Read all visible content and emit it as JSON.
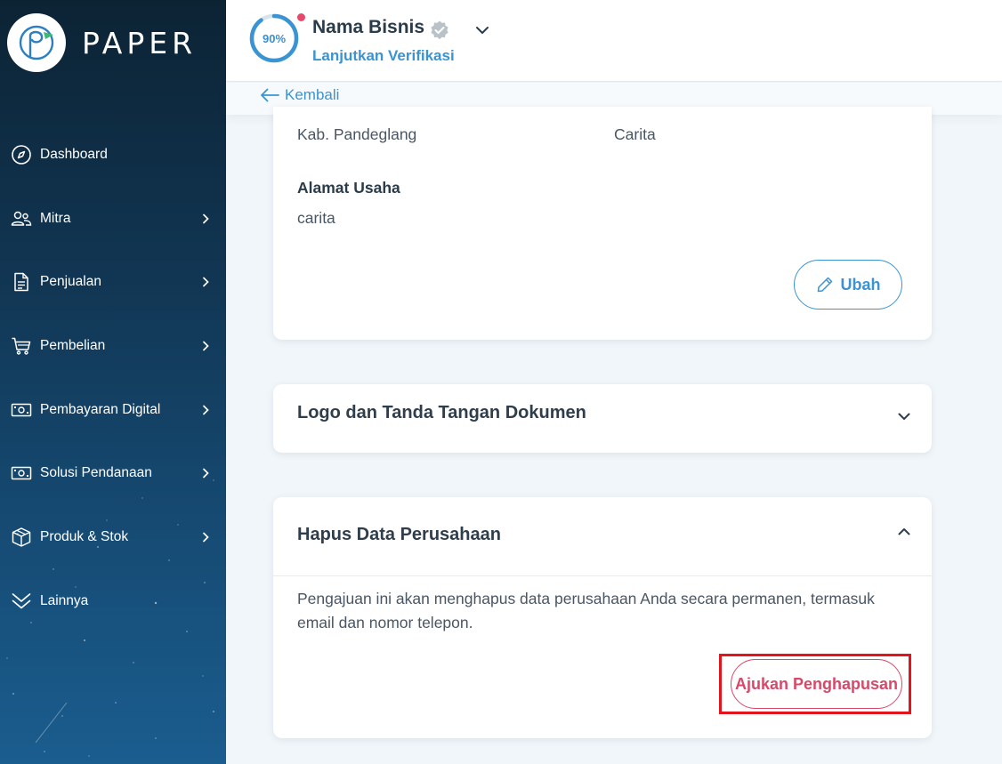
{
  "brand": {
    "name": "PAPER"
  },
  "sidebar": {
    "items": [
      {
        "label": "Dashboard",
        "icon": "compass-icon",
        "has_submenu": false
      },
      {
        "label": "Mitra",
        "icon": "users-icon",
        "has_submenu": true
      },
      {
        "label": "Penjualan",
        "icon": "document-icon",
        "has_submenu": true
      },
      {
        "label": "Pembelian",
        "icon": "cart-icon",
        "has_submenu": true
      },
      {
        "label": "Pembayaran Digital",
        "icon": "banknote-icon",
        "has_submenu": true
      },
      {
        "label": "Solusi Pendanaan",
        "icon": "banknote-icon",
        "has_submenu": true
      },
      {
        "label": "Produk & Stok",
        "icon": "box-icon",
        "has_submenu": true
      },
      {
        "label": "Lainnya",
        "icon": "double-chevron-down-icon",
        "has_submenu": false
      }
    ]
  },
  "header": {
    "progress_text": "90%",
    "progress_value": 0.9,
    "business_name": "Nama Bisnis",
    "verify_link": "Lanjutkan Verifikasi"
  },
  "backbar": {
    "label": "Kembali"
  },
  "company_card": {
    "region_left": "Kab. Pandeglang",
    "region_right": "Carita",
    "address_label": "Alamat Usaha",
    "address_value": "carita",
    "edit_button": "Ubah"
  },
  "logo_section": {
    "title": "Logo dan Tanda Tangan Dokumen"
  },
  "delete_section": {
    "title": "Hapus Data Perusahaan",
    "description": "Pengajuan ini akan menghapus data perusahaan Anda secara permanen, termasuk email dan nomor telepon.",
    "button": "Ajukan Penghapusan"
  },
  "colors": {
    "accent": "#3a93d2",
    "danger": "#d84868",
    "highlight": "#e2151c",
    "notification": "#e64a6a"
  }
}
